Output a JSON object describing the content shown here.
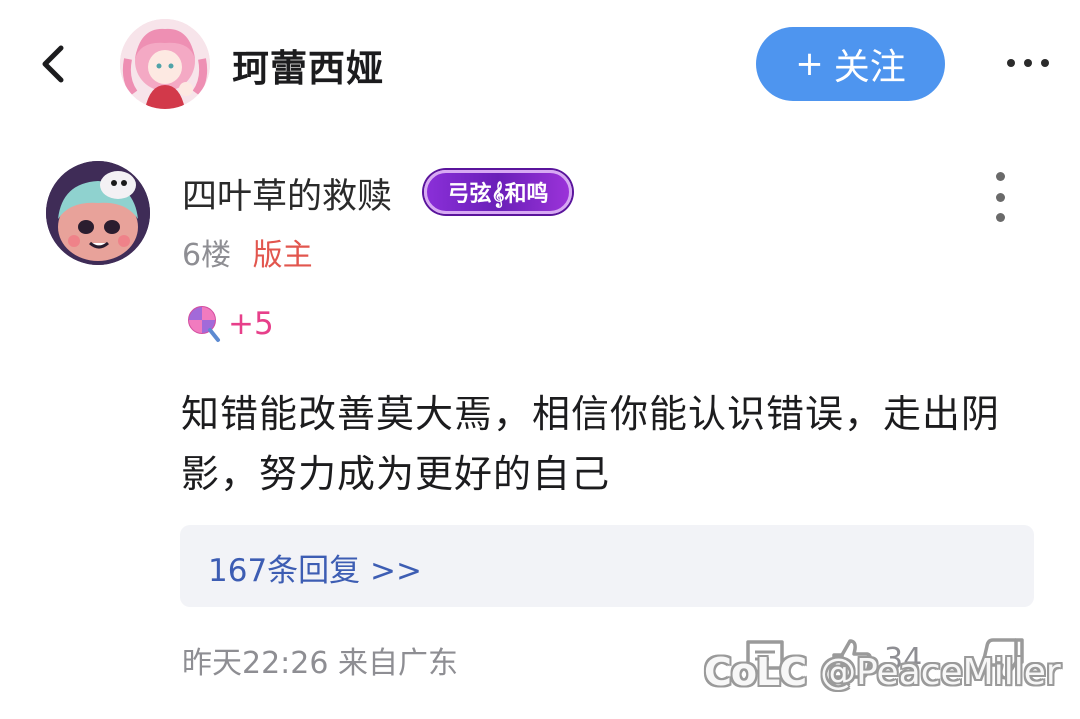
{
  "header": {
    "title": "珂蕾西娅",
    "follow_label": "关注",
    "follow_plus": "+",
    "back_icon": "chevron-left-icon",
    "more_icon": "more-horizontal-icon"
  },
  "comment": {
    "username": "四叶草的救赎",
    "fan_badge": "弓弦𝄞和鸣",
    "floor": "6楼",
    "role": "版主",
    "gift_count": "+5",
    "content": "知错能改善莫大焉，相信你能认识错误，走出阴影，努力成为更好的自己",
    "replies_link": "167条回复 >>",
    "time_location": "昨天22:26 来自广东",
    "like_count": "34"
  },
  "watermark": {
    "logo": "CoLC",
    "handle": "@PeaceMiller"
  },
  "colors": {
    "follow_button": "#4e95ef",
    "role_text": "#e2564e",
    "gift_text": "#e73f8a",
    "replies_link": "#3d5db3",
    "badge_purple": "#7a28c8"
  }
}
